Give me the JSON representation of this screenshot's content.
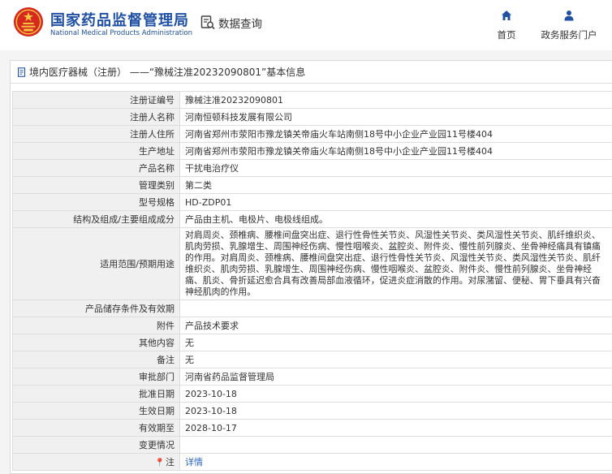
{
  "header": {
    "title_cn": "国家药品监督管理局",
    "title_en": "National Medical Products Administration",
    "query_label": "数据查询",
    "nav": {
      "home": "首页",
      "portal": "政务服务门户"
    }
  },
  "panel": {
    "title": "境内医疗器械（注册） ——“豫械注准20232090801”基本信息"
  },
  "rows": [
    {
      "label": "注册证编号",
      "value": "豫械注准20232090801"
    },
    {
      "label": "注册人名称",
      "value": "河南恒顿科技发展有限公司"
    },
    {
      "label": "注册人住所",
      "value": "河南省郑州市荥阳市豫龙镇关帝庙火车站南侧18号中小企业产业园11号楼404"
    },
    {
      "label": "生产地址",
      "value": "河南省郑州市荥阳市豫龙镇关帝庙火车站南侧18号中小企业产业园11号楼404"
    },
    {
      "label": "产品名称",
      "value": "干扰电治疗仪"
    },
    {
      "label": "管理类别",
      "value": "第二类"
    },
    {
      "label": "型号规格",
      "value": "HD-ZDP01"
    },
    {
      "label": "结构及组成/主要组成成分",
      "value": "产品由主机、电极片、电极线组成。"
    },
    {
      "label": "适用范围/预期用途",
      "value": "对肩周炎、颈椎病、腰椎间盘突出症、退行性骨性关节炎、风湿性关节炎、类风湿性关节炎、肌纤维织炎、肌肉劳损、乳腺增生、周围神经伤病、慢性咽喉炎、盆腔炎、附件炎、慢性前列腺炎、坐骨神经痛具有镇痛的作用。对肩周炎、颈椎病、腰椎间盘突出症、退行性骨性关节炎、风湿性关节炎、类风湿性关节炎、肌纤维织炎、肌肉劳损、乳腺增生、周围神经伤病、慢性咽喉炎、盆腔炎、附件炎、慢性前列腺炎、坐骨神经痛、肌炎、骨折延迟愈合具有改善局部血液循环，促进炎症消散的作用。对尿潴留、便秘、胃下垂具有兴奋神经肌肉的作用。"
    },
    {
      "label": "产品储存条件及有效期",
      "value": ""
    },
    {
      "label": "附件",
      "value": "产品技术要求"
    },
    {
      "label": "其他内容",
      "value": "无"
    },
    {
      "label": "备注",
      "value": "无"
    },
    {
      "label": "审批部门",
      "value": "河南省药品监督管理局"
    },
    {
      "label": "批准日期",
      "value": "2023-10-18"
    },
    {
      "label": "生效日期",
      "value": "2023-10-18"
    },
    {
      "label": "有效期至",
      "value": "2028-10-17"
    },
    {
      "label": "变更情况",
      "value": ""
    },
    {
      "label": "注",
      "value": "详情",
      "pin_icon": "pin-icon"
    }
  ],
  "colors": {
    "brand_blue": "#1f50a3",
    "logo_red": "#d7281f",
    "link_blue": "#2a64c5"
  }
}
